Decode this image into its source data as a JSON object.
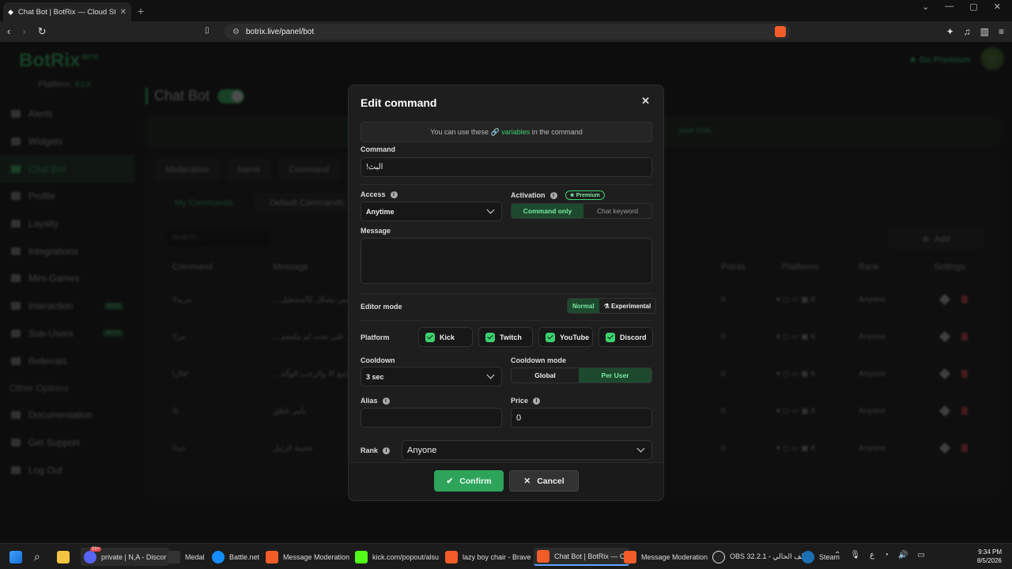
{
  "browser": {
    "tab_title": "Chat Bot | BotRix — Cloud Strea",
    "new_tab": "+",
    "url": "botrix.live/panel/bot"
  },
  "app": {
    "logo": "BotRix",
    "logo_badge": "BETA",
    "platform_label": "Platform:",
    "platform_value": "Kick",
    "premium_link": "Go Premium",
    "sidebar": {
      "items": [
        {
          "label": "Alerts"
        },
        {
          "label": "Widgets"
        },
        {
          "label": "Chat Bot"
        },
        {
          "label": "Profile"
        },
        {
          "label": "Loyalty"
        },
        {
          "label": "Integrations"
        },
        {
          "label": "Mini-Games"
        },
        {
          "label": "Interaction",
          "badge": "NEW"
        },
        {
          "label": "Sub-Users",
          "badge": "BETA"
        },
        {
          "label": "Referrals"
        }
      ],
      "group_label": "Other Options",
      "other": [
        {
          "label": "Documentation"
        },
        {
          "label": "Get Support"
        },
        {
          "label": "Log Out"
        }
      ]
    },
    "page_title": "Chat Bot",
    "banner_text": "your chat.",
    "tabs": [
      "Moderation",
      "Name",
      "Command"
    ],
    "subtabs": [
      "My Commands",
      "Default Commands"
    ],
    "search_placeholder": "Search...",
    "add_label": "Add",
    "table": {
      "columns": [
        "Command",
        "Message",
        "Points",
        "Platforms",
        "Rank",
        "Settings"
      ],
      "rows": [
        {
          "command": "!مزيدا",
          "message": "…شكلك المتعرضين يشكل كالمشغيل",
          "points": "0",
          "rank": "Anyone"
        },
        {
          "command": "!مرا",
          "message": "…هو ماسل ينمظر على تحت لم ملمعم",
          "points": "0",
          "rank": "Anyone"
        },
        {
          "command": "!قال!",
          "message": "…لذا اننت امتامع الا والرحب الوآلة",
          "points": "0",
          "rank": "Anyone"
        },
        {
          "command": "!نا",
          "message": "يأمر ناطق",
          "points": "0",
          "rank": "Anyone"
        },
        {
          "command": "!حدا",
          "message": "عجيبة الرئيل",
          "points": "0",
          "rank": "Anyone"
        }
      ]
    }
  },
  "modal": {
    "title": "Edit command",
    "hint_pre": "You can use these",
    "hint_link": "variables",
    "hint_post": "in the command",
    "command_label": "Command",
    "command_value": "!البث",
    "access_label": "Access",
    "access_value": "Anytime",
    "activation_label": "Activation",
    "premium_badge": "Premium",
    "activation_options": [
      "Command only",
      "Chat keyword"
    ],
    "message_label": "Message",
    "message_value": "",
    "editor_label": "Editor mode",
    "editor_options": [
      "Normal",
      "Experimental"
    ],
    "platform_label": "Platform",
    "platforms": [
      "Kick",
      "Twitch",
      "YouTube",
      "Discord"
    ],
    "cooldown_label": "Cooldown",
    "cooldown_value": "3 sec",
    "cooldown_mode_label": "Cooldown mode",
    "cooldown_mode_options": [
      "Global",
      "Per User"
    ],
    "alias_label": "Alias",
    "alias_value": "",
    "price_label": "Price",
    "price_value": "0",
    "rank_label": "Rank",
    "rank_value": "Anyone",
    "confirm": "Confirm",
    "cancel": "Cancel"
  },
  "taskbar": {
    "items": [
      "private | N,A - Discor",
      "Medal",
      "Battle.net",
      "Message Moderation",
      "kick.com/popout/alsu",
      "lazy boy chair - Brave",
      "Chat Bot | BotRix — Cl",
      "Message Moderation",
      "OBS 32.2.1 - الملف الحالي",
      "Steam"
    ],
    "discord_badge": "99+",
    "lang": "ع",
    "time": "9:34 PM",
    "date": "8/5/2026"
  },
  "colors": {
    "accent": "#3bd16f",
    "danger": "#e04848",
    "background": "#151515",
    "modal": "#1e1e1e"
  }
}
